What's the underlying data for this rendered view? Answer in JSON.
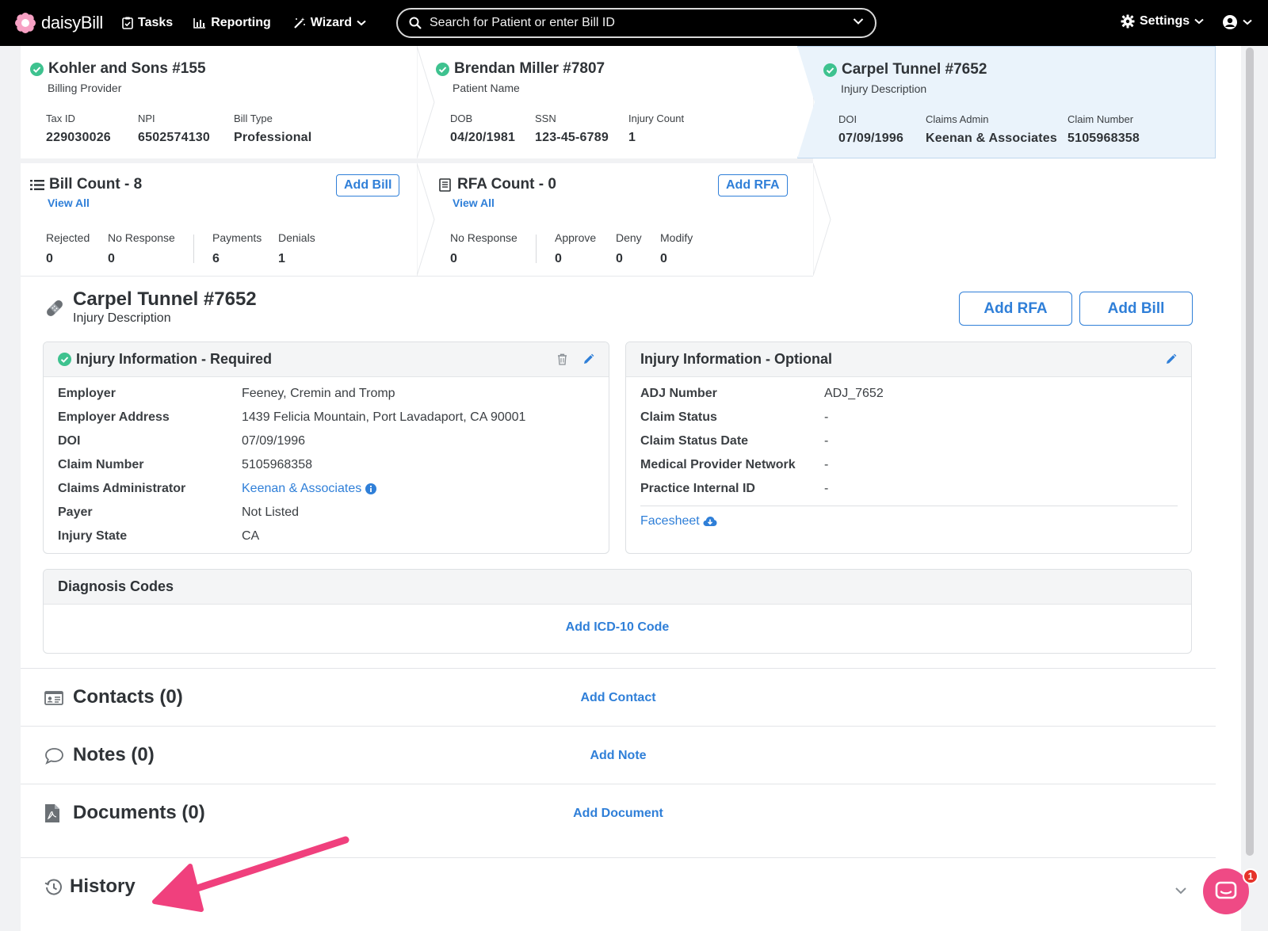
{
  "nav": {
    "logo_text": "daisyBill",
    "tasks": "Tasks",
    "reporting": "Reporting",
    "wizard": "Wizard",
    "search_placeholder": "Search for Patient or enter Bill ID",
    "settings": "Settings"
  },
  "breadcrumbs": {
    "provider": {
      "title": "Kohler and Sons #155",
      "subtitle": "Billing Provider",
      "fields": [
        {
          "label": "Tax ID",
          "value": "229030026"
        },
        {
          "label": "NPI",
          "value": "6502574130"
        },
        {
          "label": "Bill Type",
          "value": "Professional"
        }
      ]
    },
    "patient": {
      "title": "Brendan Miller #7807",
      "subtitle": "Patient Name",
      "fields": [
        {
          "label": "DOB",
          "value": "04/20/1981"
        },
        {
          "label": "SSN",
          "value": "123-45-6789"
        },
        {
          "label": "Injury Count",
          "value": "1"
        }
      ]
    },
    "injury": {
      "title": "Carpel Tunnel #7652",
      "subtitle": "Injury Description",
      "fields": [
        {
          "label": "DOI",
          "value": "07/09/1996"
        },
        {
          "label": "Claims Admin",
          "value": "Keenan & Associates"
        },
        {
          "label": "Claim Number",
          "value": "5105968358"
        }
      ]
    }
  },
  "counts": {
    "bill": {
      "title": "Bill Count - 8",
      "view_all": "View All",
      "add_label": "Add Bill",
      "fields": [
        {
          "label": "Rejected",
          "value": "0"
        },
        {
          "label": "No Response",
          "value": "0"
        },
        {
          "label": "Payments",
          "value": "6"
        },
        {
          "label": "Denials",
          "value": "1"
        }
      ]
    },
    "rfa": {
      "title": "RFA Count - 0",
      "view_all": "View All",
      "add_label": "Add RFA",
      "fields": [
        {
          "label": "No Response",
          "value": "0"
        },
        {
          "label": "Approve",
          "value": "0"
        },
        {
          "label": "Deny",
          "value": "0"
        },
        {
          "label": "Modify",
          "value": "0"
        }
      ]
    }
  },
  "injury": {
    "title": "Carpel Tunnel #7652",
    "subtitle": "Injury Description",
    "add_rfa": "Add RFA",
    "add_bill": "Add Bill",
    "required": {
      "title": "Injury Information - Required",
      "rows": [
        {
          "key": "Employer",
          "value": "Feeney, Cremin and Tromp"
        },
        {
          "key": "Employer Address",
          "value": "1439 Felicia Mountain, Port Lavadaport, CA 90001"
        },
        {
          "key": "DOI",
          "value": "07/09/1996"
        },
        {
          "key": "Claim Number",
          "value": "5105968358"
        },
        {
          "key": "Claims Administrator",
          "value": "Keenan & Associates"
        },
        {
          "key": "Payer",
          "value": "Not Listed"
        },
        {
          "key": "Injury State",
          "value": "CA"
        }
      ]
    },
    "optional": {
      "title": "Injury Information - Optional",
      "rows": [
        {
          "key": "ADJ Number",
          "value": "ADJ_7652"
        },
        {
          "key": "Claim Status",
          "value": "-"
        },
        {
          "key": "Claim Status Date",
          "value": "-"
        },
        {
          "key": "Medical Provider Network",
          "value": "-"
        },
        {
          "key": "Practice Internal ID",
          "value": "-"
        }
      ],
      "facesheet": "Facesheet"
    }
  },
  "diagnosis": {
    "title": "Diagnosis Codes",
    "add_label": "Add ICD-10 Code"
  },
  "sections": {
    "contacts": {
      "title": "Contacts (0)",
      "add_label": "Add Contact"
    },
    "notes": {
      "title": "Notes (0)",
      "add_label": "Add Note"
    },
    "documents": {
      "title": "Documents (0)",
      "add_label": "Add Document"
    },
    "history": {
      "title": "History"
    }
  },
  "chat": {
    "badge": "1"
  },
  "colors": {
    "accent": "#2f7fd8",
    "success": "#3ec28f",
    "annotation": "#f0407d",
    "nav_bg": "#000000"
  }
}
